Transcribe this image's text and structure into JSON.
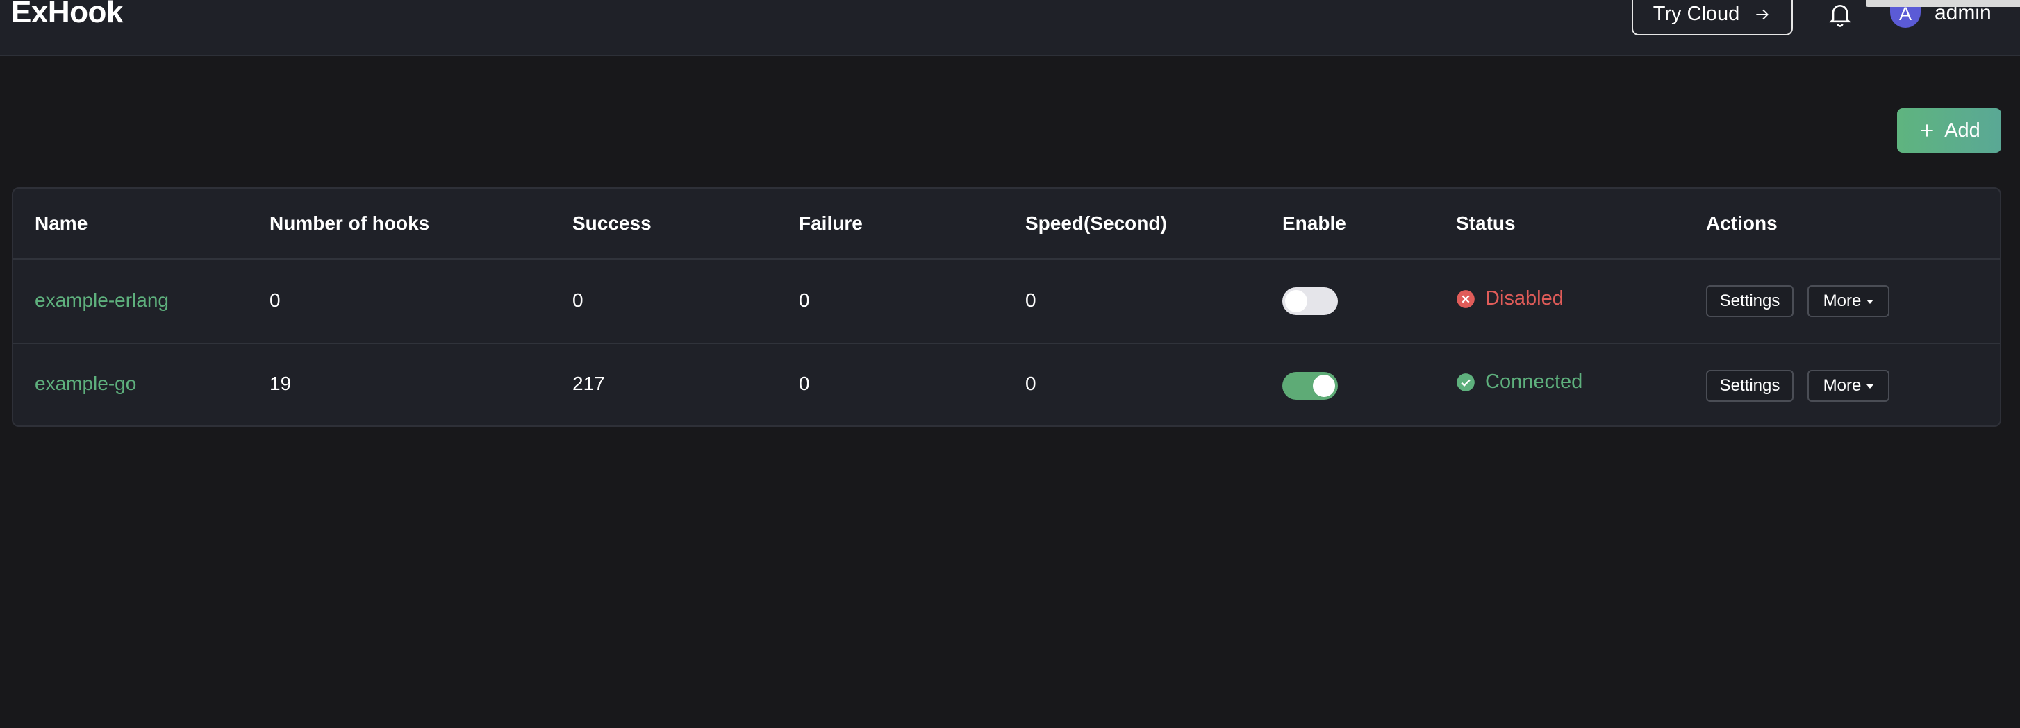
{
  "header": {
    "title": "ExHook",
    "try_cloud_label": "Try Cloud",
    "username": "admin",
    "avatar_initial": "A"
  },
  "toolbar": {
    "add_label": "Add"
  },
  "table": {
    "columns": [
      "Name",
      "Number of hooks",
      "Success",
      "Failure",
      "Speed(Second)",
      "Enable",
      "Status",
      "Actions"
    ],
    "rows": [
      {
        "name": "example-erlang",
        "hooks": "0",
        "success": "0",
        "failure": "0",
        "speed": "0",
        "enabled": false,
        "status": "Disabled",
        "settings_label": "Settings",
        "more_label": "More"
      },
      {
        "name": "example-go",
        "hooks": "19",
        "success": "217",
        "failure": "0",
        "speed": "0",
        "enabled": true,
        "status": "Connected",
        "settings_label": "Settings",
        "more_label": "More"
      }
    ]
  },
  "colors": {
    "background": "#18181b",
    "surface": "#1f2128",
    "accent_green": "#5eb07d",
    "status_error": "#e05c59",
    "avatar": "#5b5bd6"
  },
  "icons": {
    "try_cloud": "arrow-right-icon",
    "notifications": "bell-icon",
    "add": "plus-icon",
    "status_disabled": "close-circle-icon",
    "status_connected": "check-circle-icon",
    "more": "caret-down-icon"
  }
}
